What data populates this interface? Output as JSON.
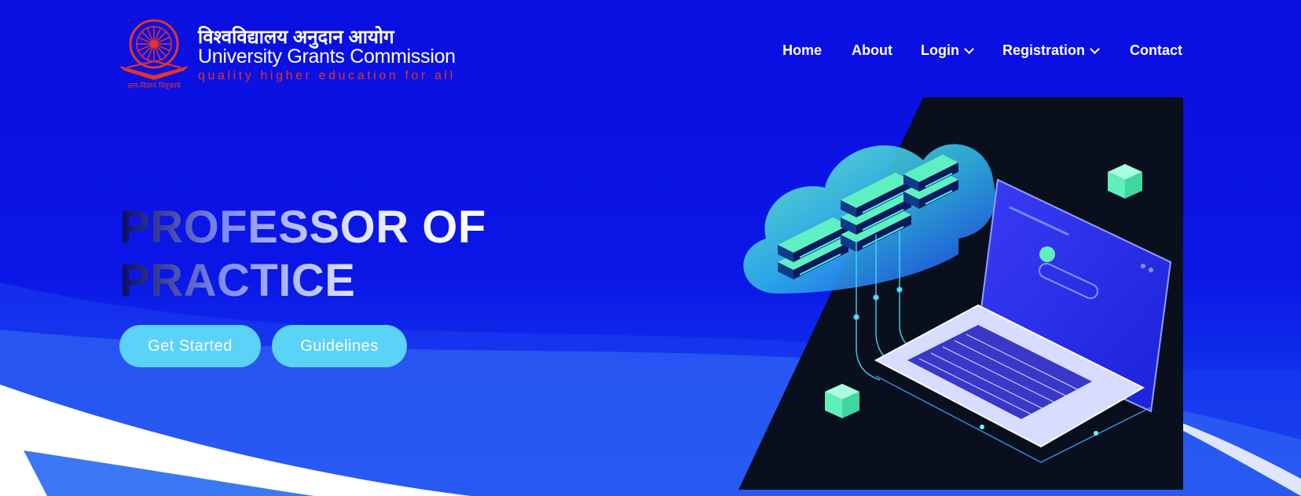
{
  "header": {
    "hindi_name": "विश्वविद्यालय अनुदान आयोग",
    "english_name": "University Grants Commission",
    "tagline": "quality higher education for all",
    "emblem_caption": "ज्ञान-विज्ञान विमुक्तये"
  },
  "nav": {
    "items": [
      {
        "label": "Home",
        "dropdown": false
      },
      {
        "label": "About",
        "dropdown": false
      },
      {
        "label": "Login",
        "dropdown": true
      },
      {
        "label": "Registration",
        "dropdown": true
      },
      {
        "label": "Contact",
        "dropdown": false
      }
    ]
  },
  "hero": {
    "title_line1": "PROFESSOR OF",
    "title_line2": "PRACTICE",
    "primary_button": "Get Started",
    "secondary_button": "Guidelines"
  },
  "colors": {
    "background": "#0b16e6",
    "button": "#5bd2f7",
    "tagline": "#e6322a",
    "illustration_panel": "#0a0f1e",
    "accent_green": "#5ff0b8"
  },
  "icons": {
    "logo": "ugc-emblem-icon",
    "dropdown": "chevron-down-icon",
    "illustration": "cloud-server-laptop-illustration"
  }
}
